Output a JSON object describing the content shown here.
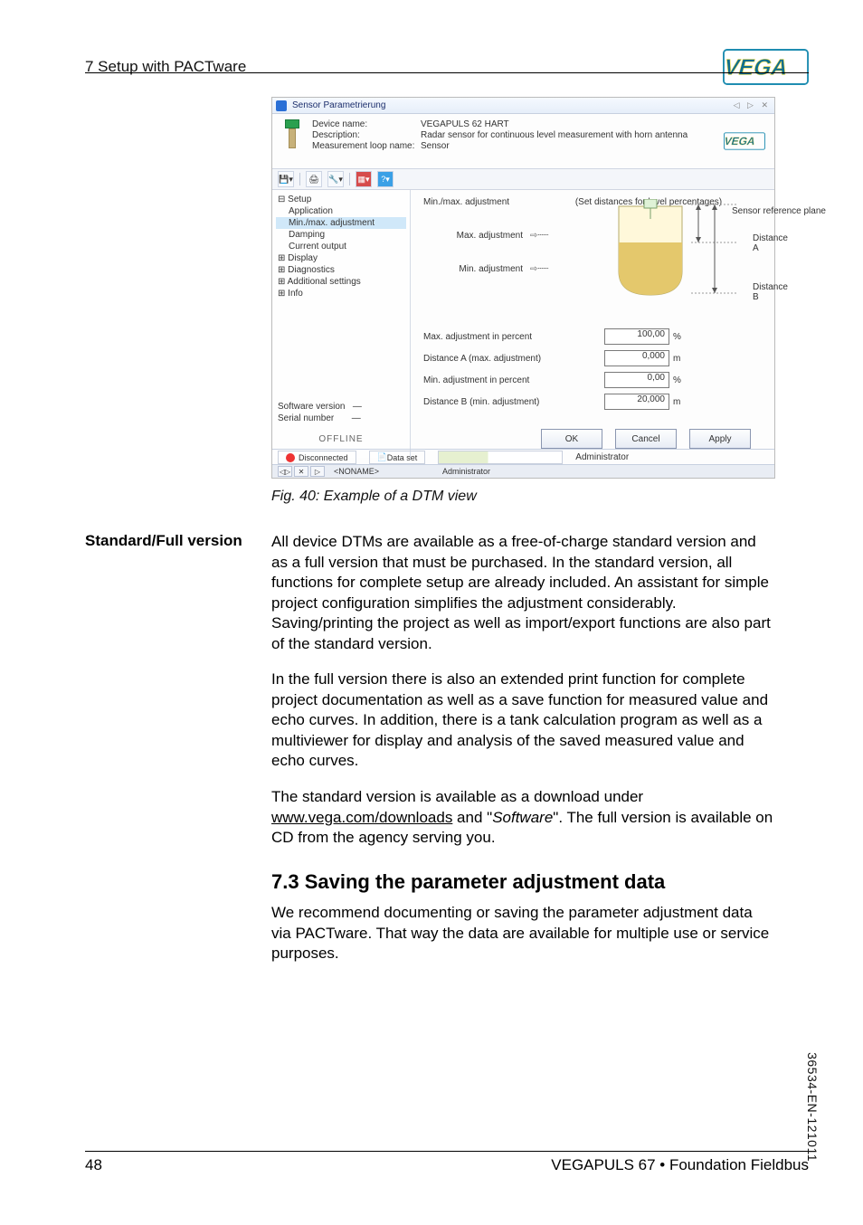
{
  "header": {
    "section": "7 Setup with PACTware"
  },
  "logo": {
    "text": "VEGA"
  },
  "screenshot": {
    "title": "Sensor Parametrierung",
    "dev": {
      "name_label": "Device name:",
      "name_value": "VEGAPULS 62 HART",
      "desc_label": "Description:",
      "desc_value": "Radar sensor for continuous level measurement with horn antenna",
      "loop_label": "Measurement loop name:",
      "loop_value": "Sensor"
    },
    "tree": {
      "setup": "Setup",
      "application": "Application",
      "minmax": "Min./max. adjustment",
      "damping": "Damping",
      "current": "Current output",
      "display": "Display",
      "diagnostics": "Diagnostics",
      "additional": "Additional settings",
      "info": "Info",
      "softver_label": "Software version",
      "softver_value": "—",
      "serial_label": "Serial number",
      "serial_value": "—",
      "offline": "OFFLINE"
    },
    "main": {
      "title": "Min./max. adjustment",
      "hint": "(Set distances for level percentages)",
      "max_adj": "Max. adjustment",
      "min_adj": "Min. adjustment",
      "sensor_plane": "Sensor reference plane",
      "distA": "Distance A",
      "distB": "Distance B",
      "fields": {
        "maxpct_label": "Max. adjustment in percent",
        "distA_label": "Distance A (max. adjustment)",
        "minpct_label": "Min. adjustment in percent",
        "distB_label": "Distance B (min. adjustment)",
        "maxpct": "100,00",
        "distA": "0,000",
        "minpct": "0,00",
        "distB": "20,000",
        "pct_unit": "%",
        "m_unit": "m"
      },
      "ok": "OK",
      "cancel": "Cancel",
      "apply": "Apply"
    },
    "status": {
      "disconnected": "Disconnected",
      "dataset": "Data set",
      "admin": "Administrator",
      "noname": "<NONAME>"
    }
  },
  "caption": "Fig. 40: Example of a DTM view",
  "margin_heading": "Standard/Full version",
  "para1": "All device DTMs are available as a free-of-charge standard version and as a full version that must be purchased. In the standard version, all functions for complete setup are already included. An assistant for simple project configuration simplifies the adjustment considerably. Saving/printing the project as well as import/export functions are also part of the standard version.",
  "para2": "In the full version there is also an extended print function for complete project documentation as well as a save function for measured value and echo curves. In addition, there is a tank calculation program as well as a multiviewer for display and analysis of the saved measured value and echo curves.",
  "para3_pre": "The standard version is available as a download under  ",
  "para3_link": "www.vega.com/downloads",
  "para3_mid": " and \"",
  "para3_em": "Software",
  "para3_post": "\". The full version is available on CD from the agency serving you.",
  "h2": "7.3   Saving the parameter adjustment data",
  "para4": "We recommend documenting or saving the parameter adjustment data via PACTware. That way the data are available for multiple use or service purposes.",
  "footer": {
    "page": "48",
    "doc": "VEGAPULS 67 • Foundation Fieldbus"
  },
  "sidecode": "36534-EN-121011"
}
